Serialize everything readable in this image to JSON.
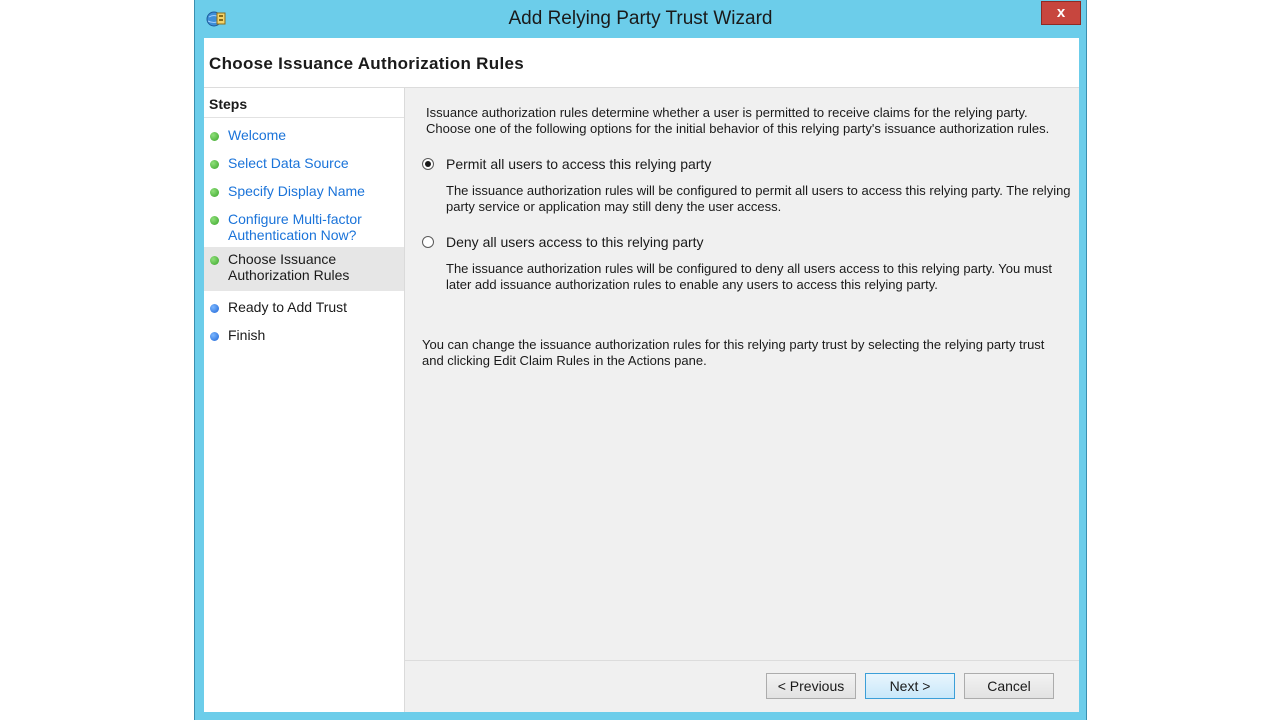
{
  "window": {
    "title": "Add Relying Party Trust Wizard",
    "close_label": "x",
    "accent_color": "#6ccdea"
  },
  "header": {
    "title": "Choose Issuance Authorization Rules"
  },
  "steps": {
    "title": "Steps",
    "items": [
      {
        "line1": "Welcome",
        "line2": "",
        "status": "complete",
        "icon": "green-dot-icon"
      },
      {
        "line1": "Select Data Source",
        "line2": "",
        "status": "complete",
        "icon": "green-dot-icon"
      },
      {
        "line1": "Specify Display Name",
        "line2": "",
        "status": "complete",
        "icon": "green-dot-icon"
      },
      {
        "line1": "Configure Multi-factor",
        "line2": "Authentication Now?",
        "status": "complete",
        "icon": "green-dot-icon"
      },
      {
        "line1": "Choose Issuance",
        "line2": "Authorization Rules",
        "status": "current",
        "icon": "green-dot-icon"
      },
      {
        "line1": "Ready to Add Trust",
        "line2": "",
        "status": "pending",
        "icon": "blue-dot-icon"
      },
      {
        "line1": "Finish",
        "line2": "",
        "status": "pending",
        "icon": "blue-dot-icon"
      }
    ]
  },
  "content": {
    "intro_line1": "Issuance authorization rules determine whether a user is permitted to receive claims for the relying party.",
    "intro_line2": "Choose one of the following options for the initial behavior of this relying party's issuance authorization rules.",
    "options": [
      {
        "label": "Permit all users to access this relying party",
        "selected": true,
        "desc_line1": "The issuance authorization rules will be configured to permit all users to access this relying party. The relying",
        "desc_line2": "party service or application may still deny the user access."
      },
      {
        "label": "Deny all users access to this relying party",
        "selected": false,
        "desc_line1": "The issuance authorization rules will be configured to deny all users access to this relying party. You must",
        "desc_line2": "later add issuance authorization rules to enable any users to access this relying party."
      }
    ],
    "note_line1": "You can change the issuance authorization rules for this relying party trust by selecting the relying party trust",
    "note_line2": "and clicking Edit Claim Rules in the Actions pane."
  },
  "buttons": {
    "previous": "< Previous",
    "next": "Next >",
    "cancel": "Cancel"
  }
}
